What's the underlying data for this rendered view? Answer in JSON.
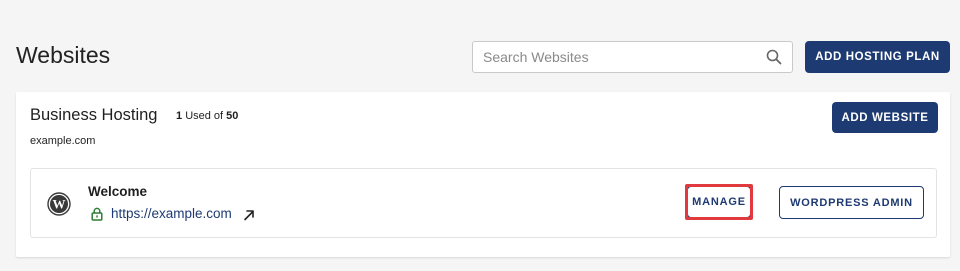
{
  "header": {
    "title": "Websites",
    "search_placeholder": "Search Websites",
    "add_hosting_plan_label": "ADD HOSTING PLAN"
  },
  "plan": {
    "name": "Business Hosting",
    "used_count": "1",
    "used_text": "Used of",
    "total_count": "50",
    "domain": "example.com",
    "add_website_label": "ADD WEBSITE"
  },
  "site": {
    "title": "Welcome",
    "url": "https://example.com",
    "manage_label": "MANAGE",
    "wordpress_admin_label": "WORDPRESS ADMIN"
  },
  "colors": {
    "primary": "#1e3a72",
    "highlight": "#e0393e",
    "lock": "#2e7d32"
  },
  "icons": [
    "search-icon",
    "wordpress-icon",
    "lock-icon",
    "external-link-icon"
  ]
}
